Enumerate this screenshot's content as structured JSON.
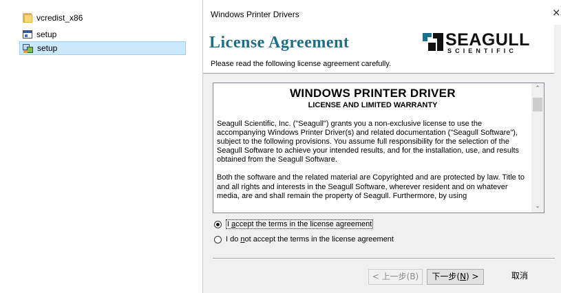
{
  "explorer": {
    "files": [
      {
        "name": "vcredist_x86",
        "icon": "folder-icon",
        "selected": false
      },
      {
        "name": "setup",
        "icon": "application-icon",
        "selected": false
      },
      {
        "name": "setup",
        "icon": "setup-installer-icon",
        "selected": true
      }
    ]
  },
  "dialog": {
    "window_title": "Windows Printer Drivers",
    "close_glyph": "×",
    "header_title": "License Agreement",
    "header_subtitle": "Please read the following license agreement carefully.",
    "logo": {
      "main": "SEAGULL",
      "sub": "SCIENTIFIC"
    },
    "license": {
      "heading": "WINDOWS PRINTER DRIVER",
      "subheading": "LICENSE AND LIMITED WARRANTY",
      "paragraph1": "Seagull Scientific, Inc. (\"Seagull\") grants you a non-exclusive license to use the accompanying Windows Printer Driver(s) and related documentation (\"Seagull Software\"), subject to the following provisions.  You assume full responsibility for the selection of the Seagull Software to achieve your intended results, and for the installation, use, and results obtained from the Seagull Software.",
      "paragraph2": "Both the software and the related material are Copyrighted and are protected by law. Title to and all rights and interests in the Seagull Software, wherever resident and on whatever media, are and shall remain the property of Seagull. Furthermore, by using"
    },
    "options": {
      "accept_prefix": "I ",
      "accept_mnemonic": "a",
      "accept_rest": "ccept the terms in the license agreement",
      "decline_prefix": "I do ",
      "decline_mnemonic": "n",
      "decline_rest": "ot accept the terms in the license agreement",
      "selected": "accept"
    },
    "buttons": {
      "back": "< 上一步(B)",
      "next_prefix": "下一步(",
      "next_mnemonic": "N",
      "next_suffix": ") >",
      "cancel": "取消"
    }
  }
}
